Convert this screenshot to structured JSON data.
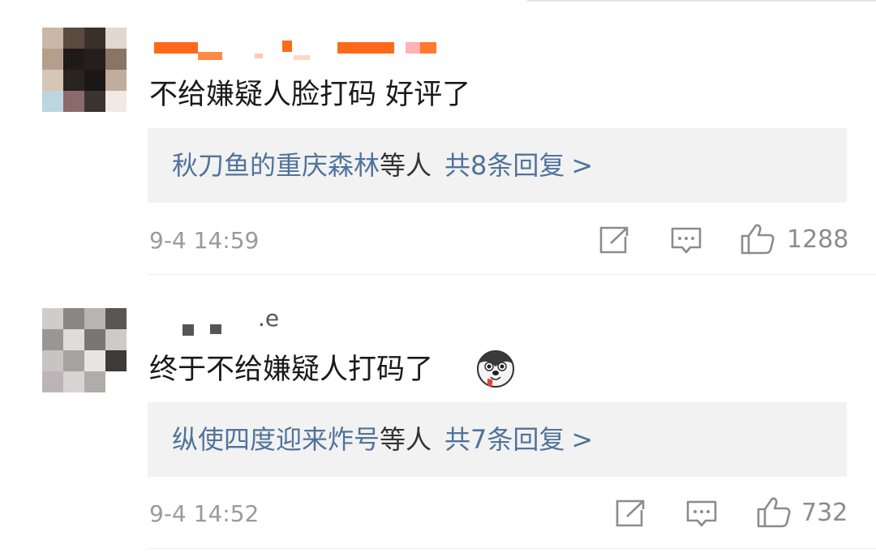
{
  "comments": [
    {
      "text": "不给嫌疑人脸打码 好评了",
      "replies": {
        "users": "秋刀鱼的重庆森林",
        "suffix": "等人",
        "count": "共8条回复",
        "arrow": ">"
      },
      "time": "9-4 14:59",
      "likes": "1288"
    },
    {
      "name_visible": ".e",
      "text": "终于不给嫌疑人打码了",
      "replies": {
        "users": "纵使四度迎来炸号",
        "suffix": "等人",
        "count": "共7条回复",
        "arrow": ">"
      },
      "time": "9-4 14:52",
      "likes": "732"
    }
  ],
  "icons": {
    "share": "share-icon",
    "comment": "comment-icon",
    "like": "like-icon",
    "emoji": "husky-emoji-icon"
  },
  "colors": {
    "link": "#51739b",
    "text": "#1a1a1a",
    "meta": "#9a9a9a",
    "reply_bg": "#f2f2f2",
    "name_redaction": "#ff6a1a"
  }
}
